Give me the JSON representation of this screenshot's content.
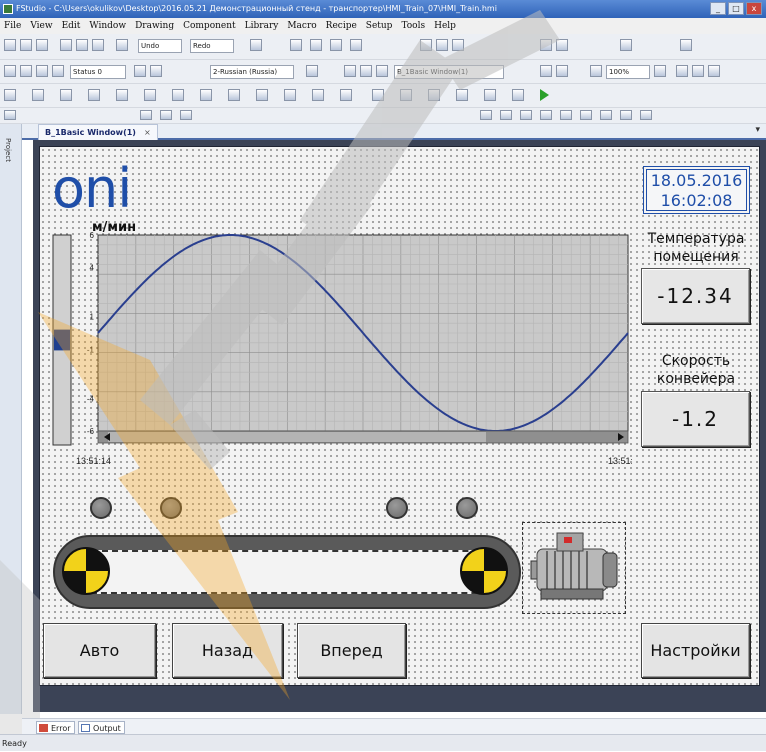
{
  "window": {
    "title": "FStudio - C:\\Users\\okulikov\\Desktop\\2016.05.21 Демонстрационный стенд - транспортер\\HMI_Train_07\\HMI_Train.hmi",
    "minimize": "_",
    "maximize": "□",
    "close": "x"
  },
  "menu": [
    "File",
    "View",
    "Edit",
    "Window",
    "Drawing",
    "Component",
    "Library",
    "Macro",
    "Recipe",
    "Setup",
    "Tools",
    "Help"
  ],
  "toolbar": {
    "undo": "Undo",
    "redo": "Redo",
    "state_select": "Status 0",
    "language_select": "2-Russian (Russia)",
    "window_select": "B_1Basic Window(1)",
    "zoom_select": "100%"
  },
  "left_panel": {
    "project_tab": "Project"
  },
  "document": {
    "tab_label": "B_1Basic Window(1)",
    "close": "×",
    "pin": "▾"
  },
  "hmi": {
    "logo": "oni",
    "chart_unit": "м/мин",
    "datetime": {
      "date": "18.05.2016",
      "time": "16:02:08"
    },
    "temperature": {
      "label_line1": "Температура",
      "label_line2": "помещения",
      "value": "-12.34"
    },
    "speed": {
      "label_line1": "Скорость",
      "label_line2": "конвейера",
      "value": "-1.2"
    },
    "buttons": {
      "auto": "Авто",
      "back": "Назад",
      "forward": "Вперед",
      "settings": "Настройки"
    }
  },
  "chart_data": {
    "type": "line",
    "title": "",
    "ylabel": "м/мин",
    "ylim": [
      -6,
      6
    ],
    "yticks": [
      "6",
      "4",
      "1",
      "-1",
      "-4",
      "-6"
    ],
    "x_start_label": "13:51:14",
    "x_end_label": "13:51:14",
    "grid": true,
    "series": [
      {
        "amplitude": 6,
        "start_value": 0,
        "period_fraction": 1.0,
        "color": "#2a3f8f"
      }
    ],
    "bar_gauge": {
      "fraction": 0.2,
      "color": "#1f3f8f"
    }
  },
  "bottom_tabs": {
    "error": "Error",
    "output": "Output"
  },
  "status": {
    "text": "Ready"
  },
  "colors": {
    "accent": "#1f4ea8",
    "canvas_frame": "#3b4356",
    "chart_line": "#2a3f8f",
    "warning_bolt": "#f6a623"
  }
}
